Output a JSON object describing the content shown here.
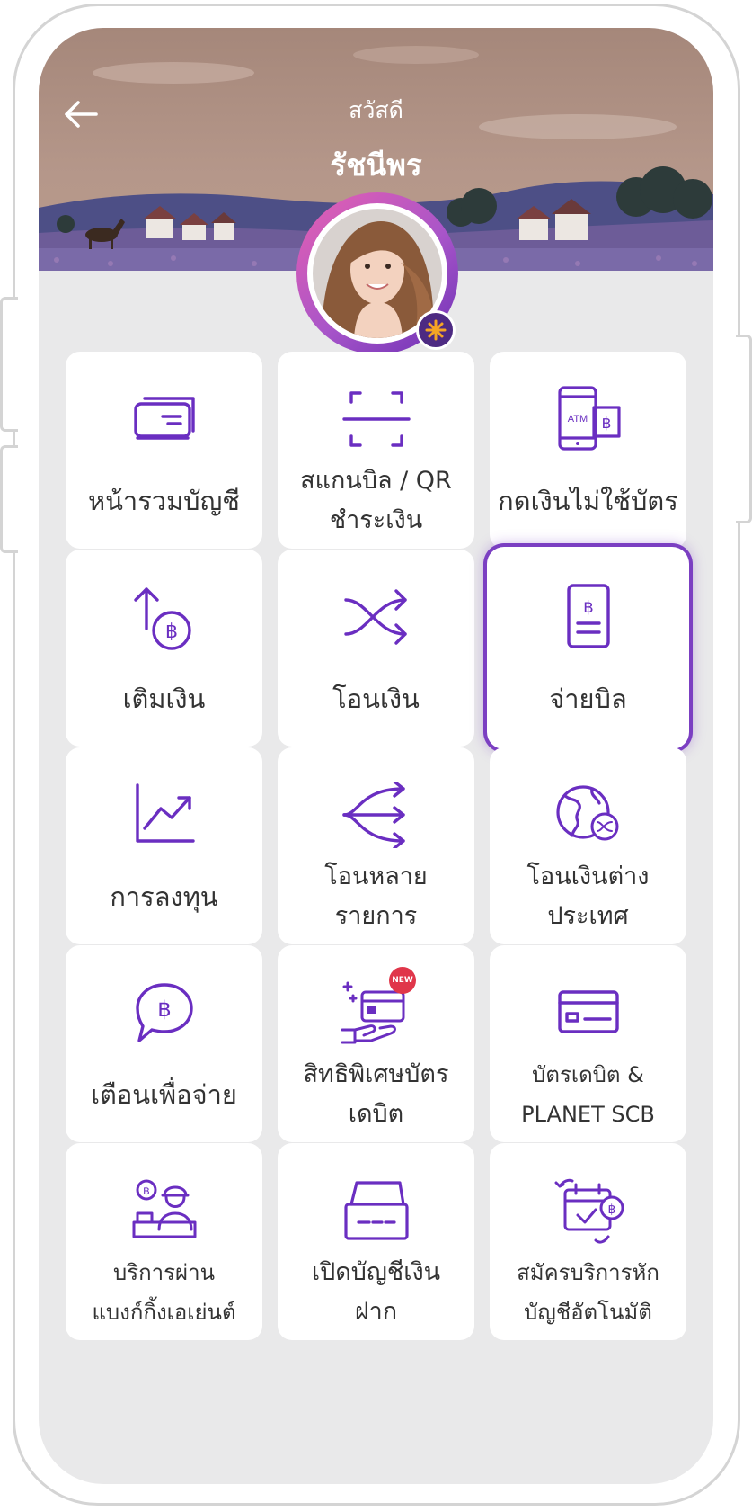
{
  "header": {
    "greeting": "สวัสดี",
    "user_name": "รัชนีพร"
  },
  "colors": {
    "accent": "#6a2ec1",
    "background": "#e9e9ea",
    "tile": "#ffffff",
    "text": "#333333",
    "new_badge": "#e0364a"
  },
  "menu": [
    {
      "id": "account-summary",
      "lines": [
        "หน้ารวมบัญชี"
      ],
      "icon": "cards-icon"
    },
    {
      "id": "scan-bill",
      "lines": [
        "สแกนบิล / QR",
        "ชำระเงิน"
      ],
      "icon": "scan-icon"
    },
    {
      "id": "cardless-withdraw",
      "lines": [
        "กดเงินไม่ใช้บัตร"
      ],
      "icon": "atm-phone-icon",
      "icon_text": "ATM"
    },
    {
      "id": "top-up",
      "lines": [
        "เติมเงิน"
      ],
      "icon": "topup-baht-icon"
    },
    {
      "id": "transfer",
      "lines": [
        "โอนเงิน"
      ],
      "icon": "shuffle-arrows-icon"
    },
    {
      "id": "pay-bill",
      "lines": [
        "จ่ายบิล"
      ],
      "icon": "bill-icon",
      "selected": true
    },
    {
      "id": "invest",
      "lines": [
        "การลงทุน"
      ],
      "icon": "chart-up-icon"
    },
    {
      "id": "bulk-transfer",
      "lines": [
        "โอนหลาย",
        "รายการ"
      ],
      "icon": "multi-transfer-icon"
    },
    {
      "id": "international-transfer",
      "lines": [
        "โอนเงินต่าง",
        "ประเทศ"
      ],
      "icon": "globe-transfer-icon"
    },
    {
      "id": "payment-reminder",
      "lines": [
        "เตือนเพื่อจ่าย"
      ],
      "icon": "chat-baht-icon"
    },
    {
      "id": "debit-privileges",
      "lines": [
        "สิทธิพิเศษบัตร",
        "เดบิต"
      ],
      "icon": "card-hand-icon",
      "badge": "NEW"
    },
    {
      "id": "credit-card",
      "lines": [
        "บัตรเดบิต &",
        "PLANET SCB"
      ],
      "icon": "credit-card-icon"
    },
    {
      "id": "banking-agent",
      "lines": [
        "บริการผ่าน",
        "แบงก์กิ้งเอเย่นต์"
      ],
      "icon": "agent-icon"
    },
    {
      "id": "open-account",
      "lines": [
        "เปิดบัญชีเงิน",
        "ฝาก"
      ],
      "icon": "open-account-icon"
    },
    {
      "id": "auto-debit",
      "lines": [
        "สมัครบริการหัก",
        "บัญชีอัตโนมัติ"
      ],
      "icon": "calendar-debit-icon"
    }
  ]
}
